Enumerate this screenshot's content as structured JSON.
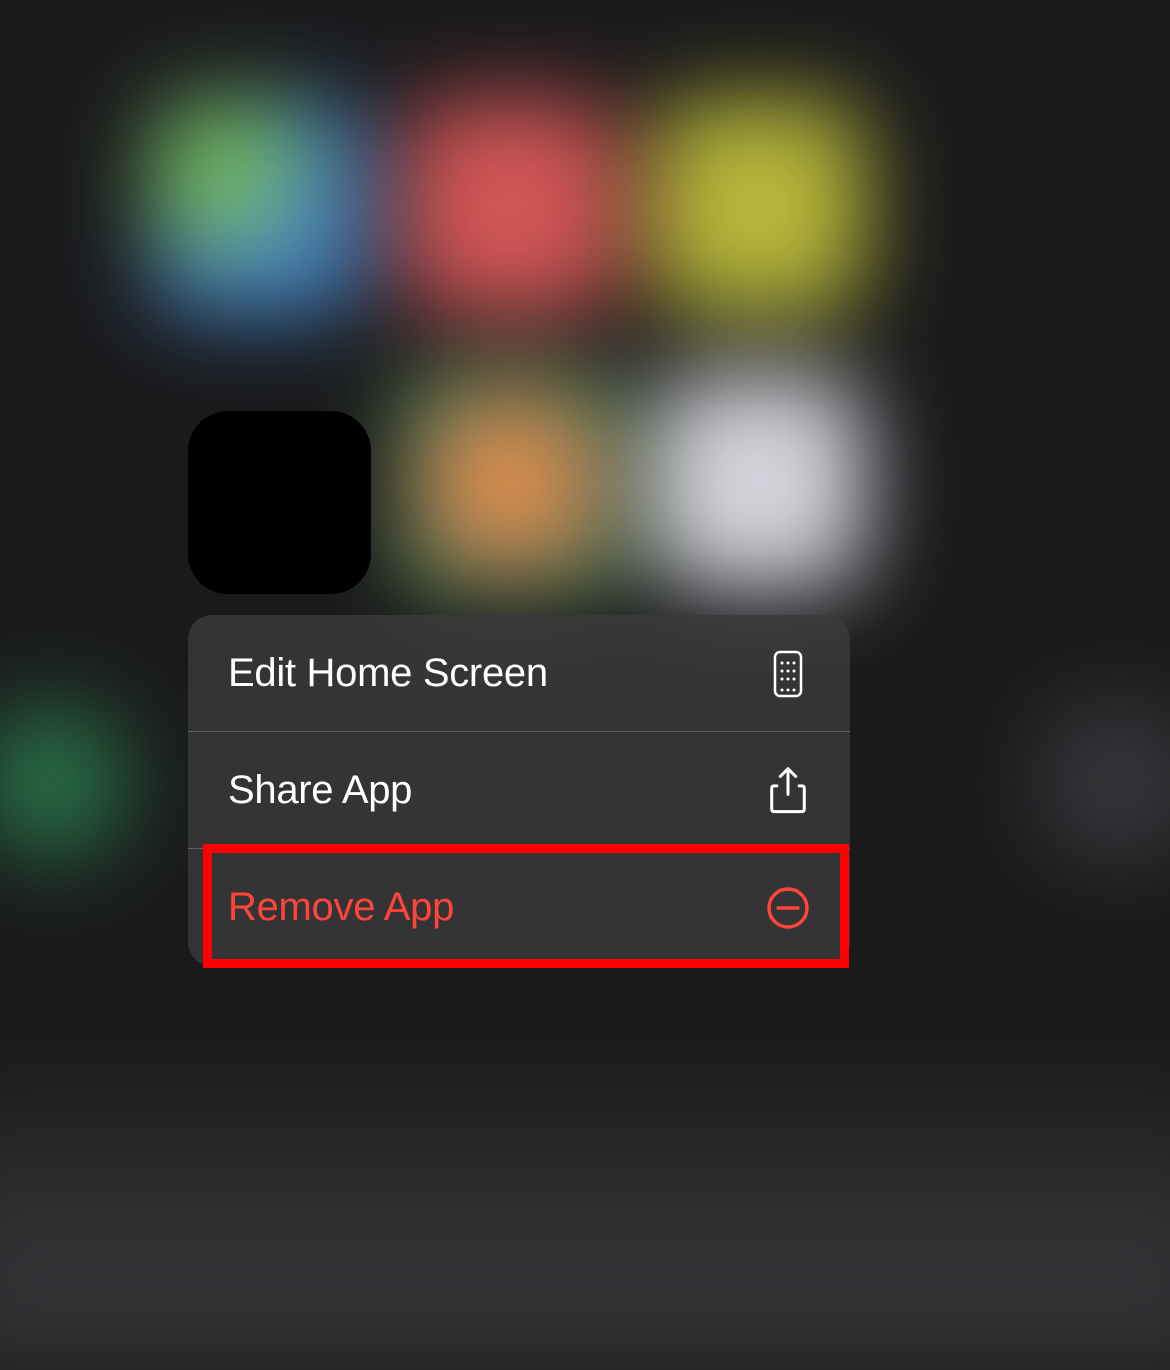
{
  "menu": {
    "items": [
      {
        "label": "Edit Home Screen",
        "icon": "home-screen-grid-icon",
        "destructive": false
      },
      {
        "label": "Share App",
        "icon": "share-icon",
        "destructive": false
      },
      {
        "label": "Remove App",
        "icon": "minus-circle-icon",
        "destructive": true
      }
    ]
  },
  "annotation": {
    "highlighted_item_index": 2
  }
}
